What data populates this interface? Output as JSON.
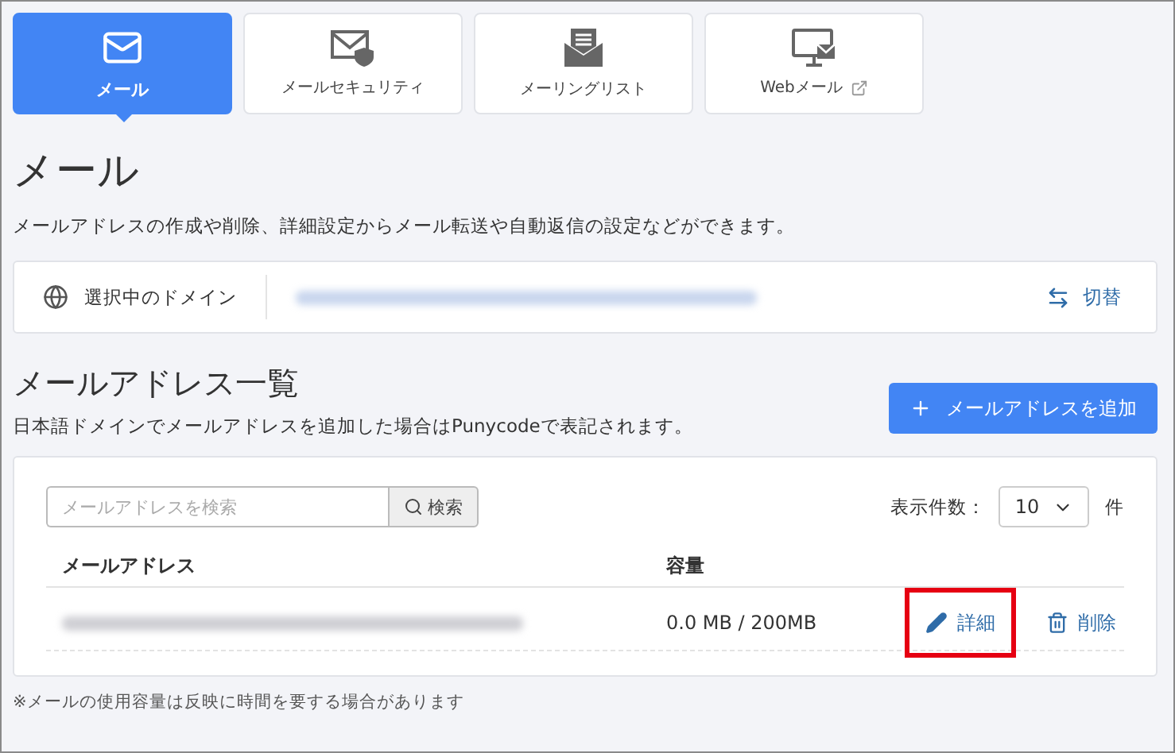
{
  "tabs": [
    {
      "label": "メール",
      "kind": "mail",
      "selected": true,
      "external": false
    },
    {
      "label": "メールセキュリティ",
      "kind": "shield",
      "selected": false,
      "external": false
    },
    {
      "label": "メーリングリスト",
      "kind": "list",
      "selected": false,
      "external": false
    },
    {
      "label": "Webメール",
      "kind": "monitor",
      "selected": false,
      "external": true
    }
  ],
  "page": {
    "title": "メール",
    "description": "メールアドレスの作成や削除、詳細設定からメール転送や自動返信の設定などができます。"
  },
  "domain_bar": {
    "label": "選択中のドメイン",
    "redacted": true,
    "switch_label": "切替"
  },
  "list": {
    "title": "メールアドレス一覧",
    "note": "日本語ドメインでメールアドレスを追加した場合はPunycodeで表記されます。",
    "add_button": "メールアドレスを追加",
    "search": {
      "placeholder": "メールアドレスを検索",
      "button": "検索"
    },
    "page_size": {
      "label": "表示件数：",
      "value": "10",
      "unit": "件"
    },
    "columns": [
      "メールアドレス",
      "容量"
    ],
    "rows": [
      {
        "redacted": true,
        "usage": "0.0 MB / 200MB",
        "actions": [
          {
            "kind": "edit",
            "label": "詳細",
            "highlighted": true
          },
          {
            "kind": "delete",
            "label": "削除",
            "highlighted": false
          }
        ]
      }
    ]
  },
  "footnote": "※メールの使用容量は反映に時間を要する場合があります"
}
